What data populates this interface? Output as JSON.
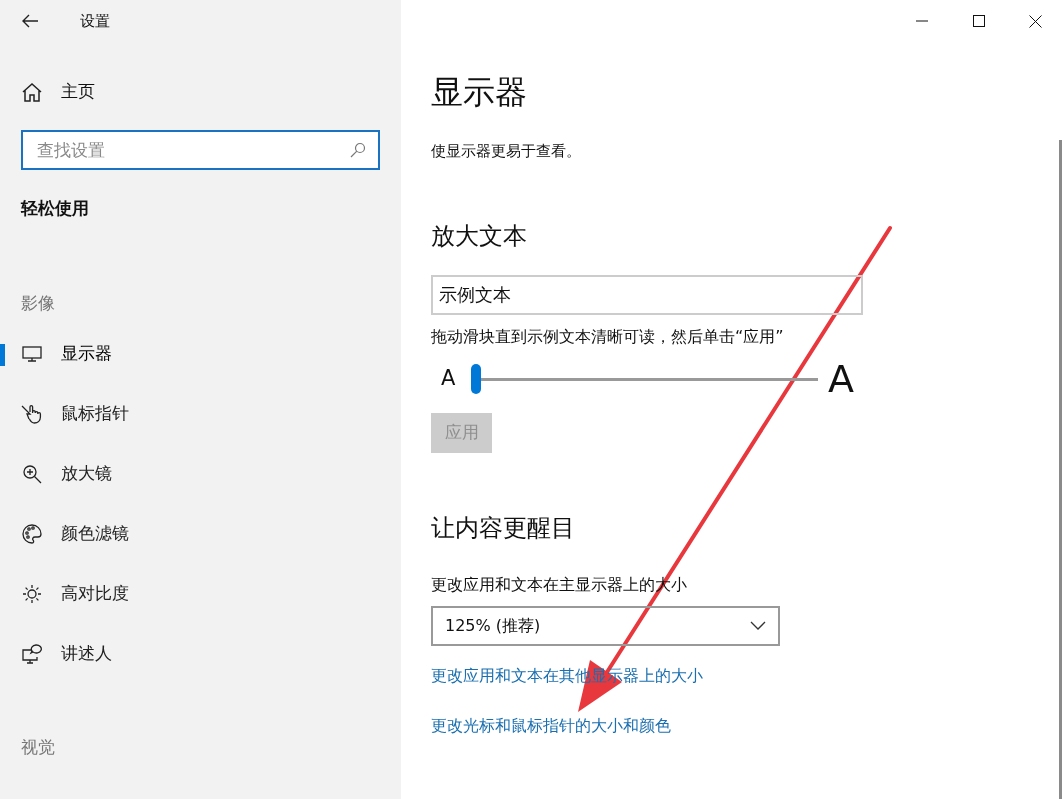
{
  "window": {
    "title": "设置"
  },
  "sidebar": {
    "home": "主页",
    "search": {
      "placeholder": "查找设置"
    },
    "category": "轻松使用",
    "entries": [
      {
        "kind": "heading",
        "label": "影像"
      },
      {
        "kind": "item",
        "label": "显示器",
        "selected": true
      },
      {
        "kind": "item",
        "label": "鼠标指针",
        "selected": false
      },
      {
        "kind": "item",
        "label": "放大镜",
        "selected": false
      },
      {
        "kind": "item",
        "label": "颜色滤镜",
        "selected": false
      },
      {
        "kind": "item",
        "label": "高对比度",
        "selected": false
      },
      {
        "kind": "item",
        "label": "讲述人",
        "selected": false
      },
      {
        "kind": "heading",
        "label": "视觉"
      }
    ]
  },
  "main": {
    "title": "显示器",
    "subtitle": "使显示器更易于查看。",
    "text_size": {
      "heading": "放大文本",
      "sample": "示例文本",
      "hint": "拖动滑块直到示例文本清晰可读，然后单击“应用”",
      "small_label": "A",
      "large_label": "A",
      "level": 0,
      "apply_button": {
        "label": "应用",
        "disabled": true
      }
    },
    "visibility": {
      "heading": "让内容更醒目",
      "scale_label": "更改应用和文本在主显示器上的大小",
      "dropdown": {
        "value": "125% (推荐)"
      },
      "links": [
        "更改应用和文本在其他显示器上的大小",
        "更改光标和鼠标指针的大小和颜色"
      ]
    }
  }
}
